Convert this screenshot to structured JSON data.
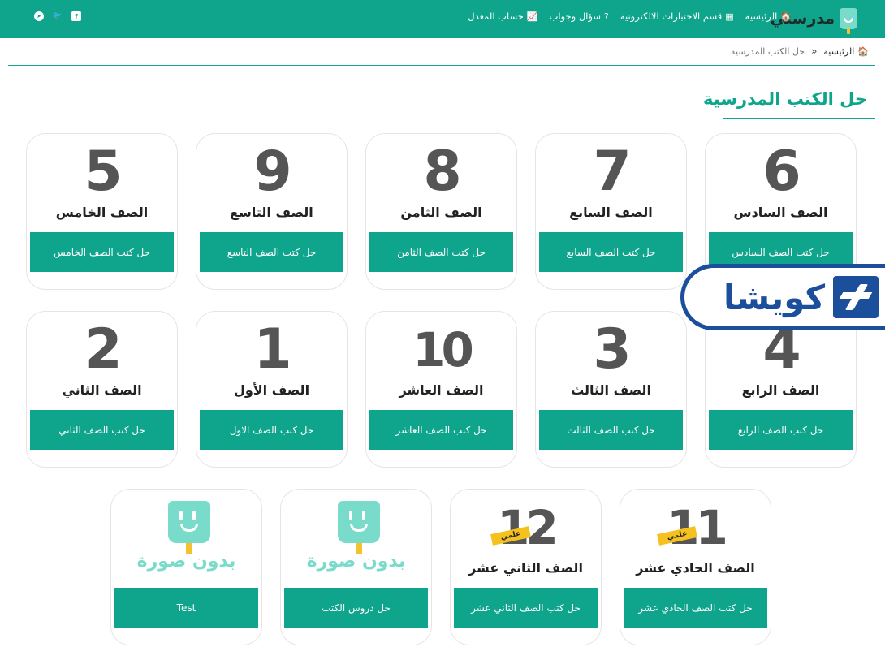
{
  "brand": {
    "name": "مدرستي"
  },
  "nav": [
    {
      "label": "الرئيسية",
      "icon": "home-icon",
      "glyph": "🏠"
    },
    {
      "label": "قسم الاختبارات الالكترونية",
      "icon": "calculator-icon",
      "glyph": "▦"
    },
    {
      "label": "سؤال وجواب",
      "icon": "question-icon",
      "glyph": "?"
    },
    {
      "label": "حساب المعدل",
      "icon": "chart-icon",
      "glyph": "📈"
    }
  ],
  "social": [
    {
      "name": "facebook-icon",
      "glyph": "f"
    },
    {
      "name": "twitter-icon",
      "glyph": "🐦"
    },
    {
      "name": "telegram-icon",
      "glyph": "➤"
    }
  ],
  "breadcrumb": {
    "home": "الرئيسية",
    "separator": "»",
    "current": "حل الكتب المدرسية"
  },
  "page_title": "حل الكتب المدرسية",
  "cards": [
    {
      "num": "6",
      "grade": "الصف السادس",
      "button": "حل كتب الصف السادس"
    },
    {
      "num": "7",
      "grade": "الصف السابع",
      "button": "حل كتب الصف السابع"
    },
    {
      "num": "8",
      "grade": "الصف الثامن",
      "button": "حل كتب الصف الثامن"
    },
    {
      "num": "9",
      "grade": "الصف التاسع",
      "button": "حل كتب الصف التاسع"
    },
    {
      "num": "5",
      "grade": "الصف الخامس",
      "button": "حل كتب الصف الخامس"
    },
    {
      "num": "4",
      "grade": "الصف الرابع",
      "button": "حل كتب الصف الرابع"
    },
    {
      "num": "3",
      "grade": "الصف الثالث",
      "button": "حل كتب الصف الثالث"
    },
    {
      "num": "10",
      "grade": "الصف العاشر",
      "button": "حل كتب الصف العاشر"
    },
    {
      "num": "1",
      "grade": "الصف الأول",
      "button": "حل كتب الصف الاول"
    },
    {
      "num": "2",
      "grade": "الصف الثاني",
      "button": "حل كتب الصف الثاني"
    },
    {
      "num": "11",
      "badge": "علمي",
      "grade": "الصف الحادي عشر",
      "button": "حل كتب الصف الحادي عشر"
    },
    {
      "num": "12",
      "badge": "علمي",
      "grade": "الصف الثاني عشر",
      "button": "حل كتب الصف الثاني عشر"
    },
    {
      "noimage": "بدون صورة",
      "button": "حل دروس الكتب"
    },
    {
      "noimage": "بدون صورة",
      "button": "Test"
    }
  ],
  "watermark": {
    "text": "كويشا"
  },
  "colors": {
    "primary": "#0fa48c",
    "accent": "#f4c11f",
    "watermark": "#1b4f9c"
  }
}
